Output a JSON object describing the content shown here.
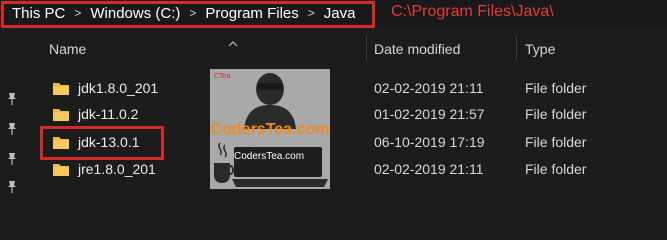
{
  "breadcrumb": {
    "items": [
      "This PC",
      "Windows (C:)",
      "Program Files",
      "Java"
    ],
    "separator": ">"
  },
  "annotation": {
    "path_text": "C:\\Program Files\\Java\\",
    "highlight_color": "#d42a2a"
  },
  "columns": {
    "name": "Name",
    "date_modified": "Date modified",
    "type": "Type"
  },
  "rows": [
    {
      "name": "jdk1.8.0_201",
      "date": "02-02-2019 21:11",
      "type": "File folder"
    },
    {
      "name": "jdk-11.0.2",
      "date": "01-02-2019 21:57",
      "type": "File folder"
    },
    {
      "name": "jdk-13.0.1",
      "date": "06-10-2019 17:19",
      "type": "File folder",
      "highlighted": true
    },
    {
      "name": "jre1.8.0_201",
      "date": "02-02-2019 21:11",
      "type": "File folder"
    }
  ],
  "logo": {
    "badge": "CTea",
    "brand": "CodersTea.com",
    "brand_small": "CodersTea.com",
    "brand_color": "#f28a1e"
  },
  "icons": {
    "folder": "folder-icon",
    "pin": "pin-icon",
    "separator": "chevron-right-icon",
    "sort": "chevron-up-icon"
  },
  "theme": {
    "background": "#1c1c1c",
    "folder_color": "#e8b84a"
  }
}
